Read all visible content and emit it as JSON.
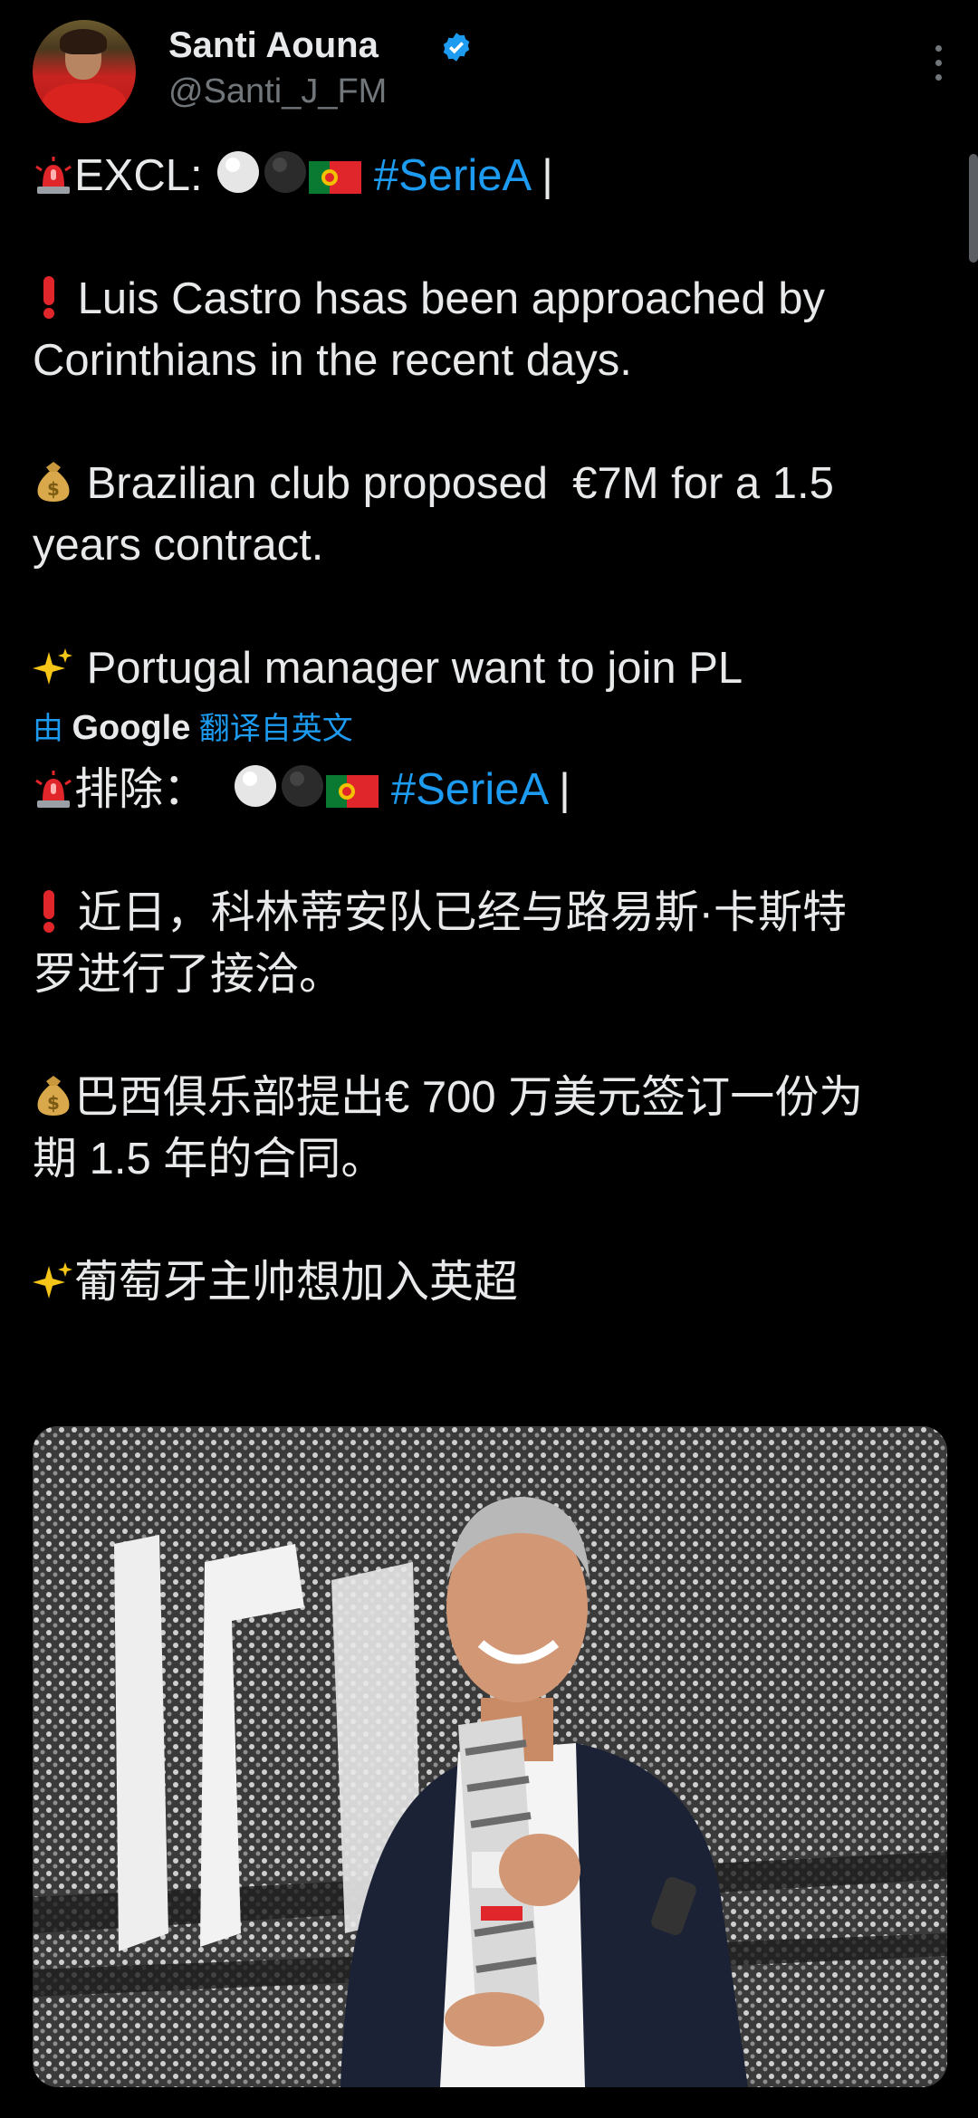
{
  "header": {
    "name": "Santi Aouna",
    "handle": "@Santi_J_FM",
    "verified_color": "#1d9bf0"
  },
  "tweet": {
    "original": {
      "line1_prefix": "EXCL: ",
      "line1_hashtag": "#SerieA",
      "line1_suffix": " |",
      "line2a": "Luis Castro hsas been approached by",
      "line2b": "Corinthians in the recent days.",
      "line3a": " Brazilian club proposed  €7M for a 1.5",
      "line3b": "years contract.",
      "line4": " Portugal manager want to join PL"
    },
    "translation_label_prefix": "由 ",
    "translation_label_brand": "Google",
    "translation_label_suffix": " 翻译自英文",
    "translated": {
      "line1_prefix": "排除：  ",
      "line1_hashtag": "#SerieA",
      "line1_suffix": " |",
      "line2a": "近日，科林蒂安队已经与路易斯·卡斯特",
      "line2b": "罗进行了接洽。",
      "line3a": "巴西俱乐部提出€ 700 万美元签订一份为",
      "line3b": "期 1.5 年的合同。",
      "line4": "葡萄牙主帅想加入英超"
    }
  },
  "icons": {
    "siren": "police-light-icon",
    "exclamation": "red-exclamation-icon",
    "moneybag": "money-bag-icon",
    "sparkles": "sparkles-icon",
    "white_circle": "white-circle-icon",
    "black_circle": "black-circle-icon",
    "flag": "portugal-flag-icon"
  },
  "colors": {
    "background": "#000000",
    "text": "#e7e9ea",
    "secondary": "#71767b",
    "link": "#1d9bf0"
  }
}
